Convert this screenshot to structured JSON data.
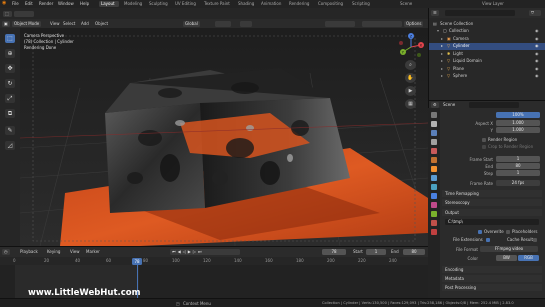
{
  "topbar": {
    "menu": [
      "File",
      "Edit",
      "Render",
      "Window",
      "Help"
    ],
    "workspaces": [
      "Layout",
      "Modeling",
      "Sculpting",
      "UV Editing",
      "Texture Paint",
      "Shading",
      "Animation",
      "Rendering",
      "Compositing",
      "Scripting"
    ],
    "active_workspace": "Layout",
    "scene": "Scene",
    "view_layer": "View Layer"
  },
  "viewport_header": {
    "mode": "Object Mode",
    "menus": [
      "View",
      "Select",
      "Add",
      "Object"
    ],
    "transform": "Global",
    "options": "Options"
  },
  "viewport": {
    "info_lines": [
      "Camera Perspective",
      "(78) Collection | Cylinder",
      "Rendering Done"
    ]
  },
  "gizmo": {
    "x": "X",
    "y": "Y",
    "z": "Z"
  },
  "outliner": {
    "search_placeholder": "",
    "rows": [
      {
        "label": "Scene Collection"
      },
      {
        "label": "Collection"
      },
      {
        "label": "Camera"
      },
      {
        "label": "Cylinder"
      },
      {
        "label": "Light"
      },
      {
        "label": "Liquid Domain"
      },
      {
        "label": "Plane"
      },
      {
        "label": "Sphere"
      }
    ],
    "selected_row": "Cylinder"
  },
  "properties": {
    "breadcrumb": "Scene",
    "resolution_pct": "100%",
    "aspect_label": "Aspect X",
    "aspect_x": "1.000",
    "aspect_y_label": "Y",
    "aspect_y": "1.000",
    "render_region": "Render Region",
    "crop_region": "Crop to Render Region",
    "frame_start_label": "Frame Start",
    "frame_start": "1",
    "end_label": "End",
    "frame_end": "80",
    "step_label": "Step",
    "frame_step": "1",
    "frame_rate_label": "Frame Rate",
    "frame_rate": "24 fps",
    "time_remapping": "Time Remapping",
    "stereoscopy": "Stereoscopy",
    "output": "Output",
    "output_path": "C:\\tmp\\",
    "overwrite": "Overwrite",
    "placeholders": "Placeholders",
    "file_extensions": "File Extensions",
    "cache_result": "Cache Result",
    "file_format_label": "File Format",
    "file_format": "FFmpeg video",
    "color_label": "Color",
    "color_bw": "BW",
    "color_rgb": "RGB",
    "encoding": "Encoding",
    "metadata": "Metadata",
    "post_processing": "Post Processing"
  },
  "timeline": {
    "menus": [
      "Playback",
      "Keying",
      "View",
      "Marker"
    ],
    "current_frame": "78",
    "start_label": "Start",
    "start": "1",
    "end_label": "End",
    "end": "80",
    "ticks": [
      "0",
      "20",
      "40",
      "60",
      "80",
      "100",
      "120",
      "140",
      "160",
      "180",
      "200",
      "220",
      "240"
    ]
  },
  "status": {
    "context_menu": "Context Menu",
    "stats": "Collection | Cylinder | Verts:130,500 | Faces:129,093 | Tris:258,186 | Objects:0/8 | Mem: 252.4 MiB | 2.83.0"
  },
  "watermark": "www.LittleWebHut.com",
  "colors": {
    "accent": "#4772b3",
    "floor": "#d6531f",
    "selected_row": "#334d80"
  }
}
